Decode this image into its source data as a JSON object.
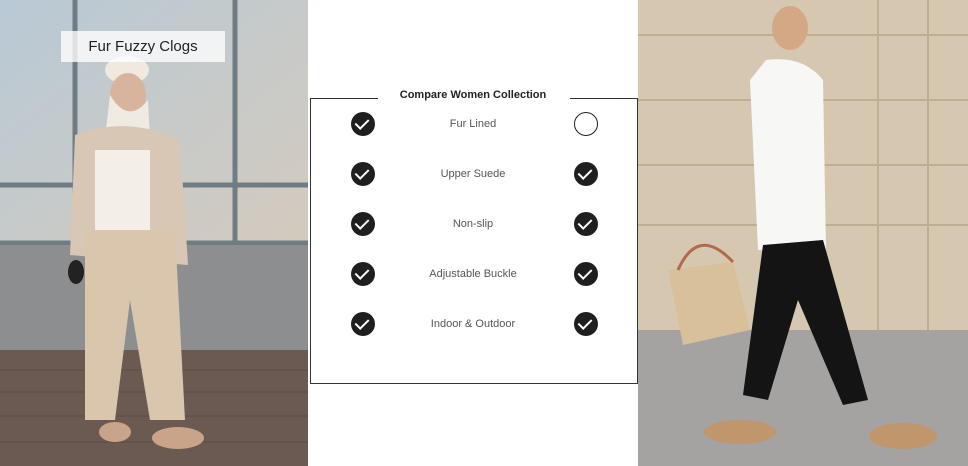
{
  "left_panel": {
    "tag": "Fur Fuzzy Clogs"
  },
  "comparison": {
    "title": "Compare Women Collection",
    "rows": [
      {
        "label": "Fur Lined",
        "left": "check-icon",
        "right": "empty-circle-icon"
      },
      {
        "label": "Upper Suede",
        "left": "check-icon",
        "right": "check-icon"
      },
      {
        "label": "Non-slip",
        "left": "check-icon",
        "right": "check-icon"
      },
      {
        "label": "Adjustable Buckle",
        "left": "check-icon",
        "right": "check-icon"
      },
      {
        "label": "Indoor & Outdoor",
        "left": "check-icon",
        "right": "check-icon"
      }
    ]
  }
}
